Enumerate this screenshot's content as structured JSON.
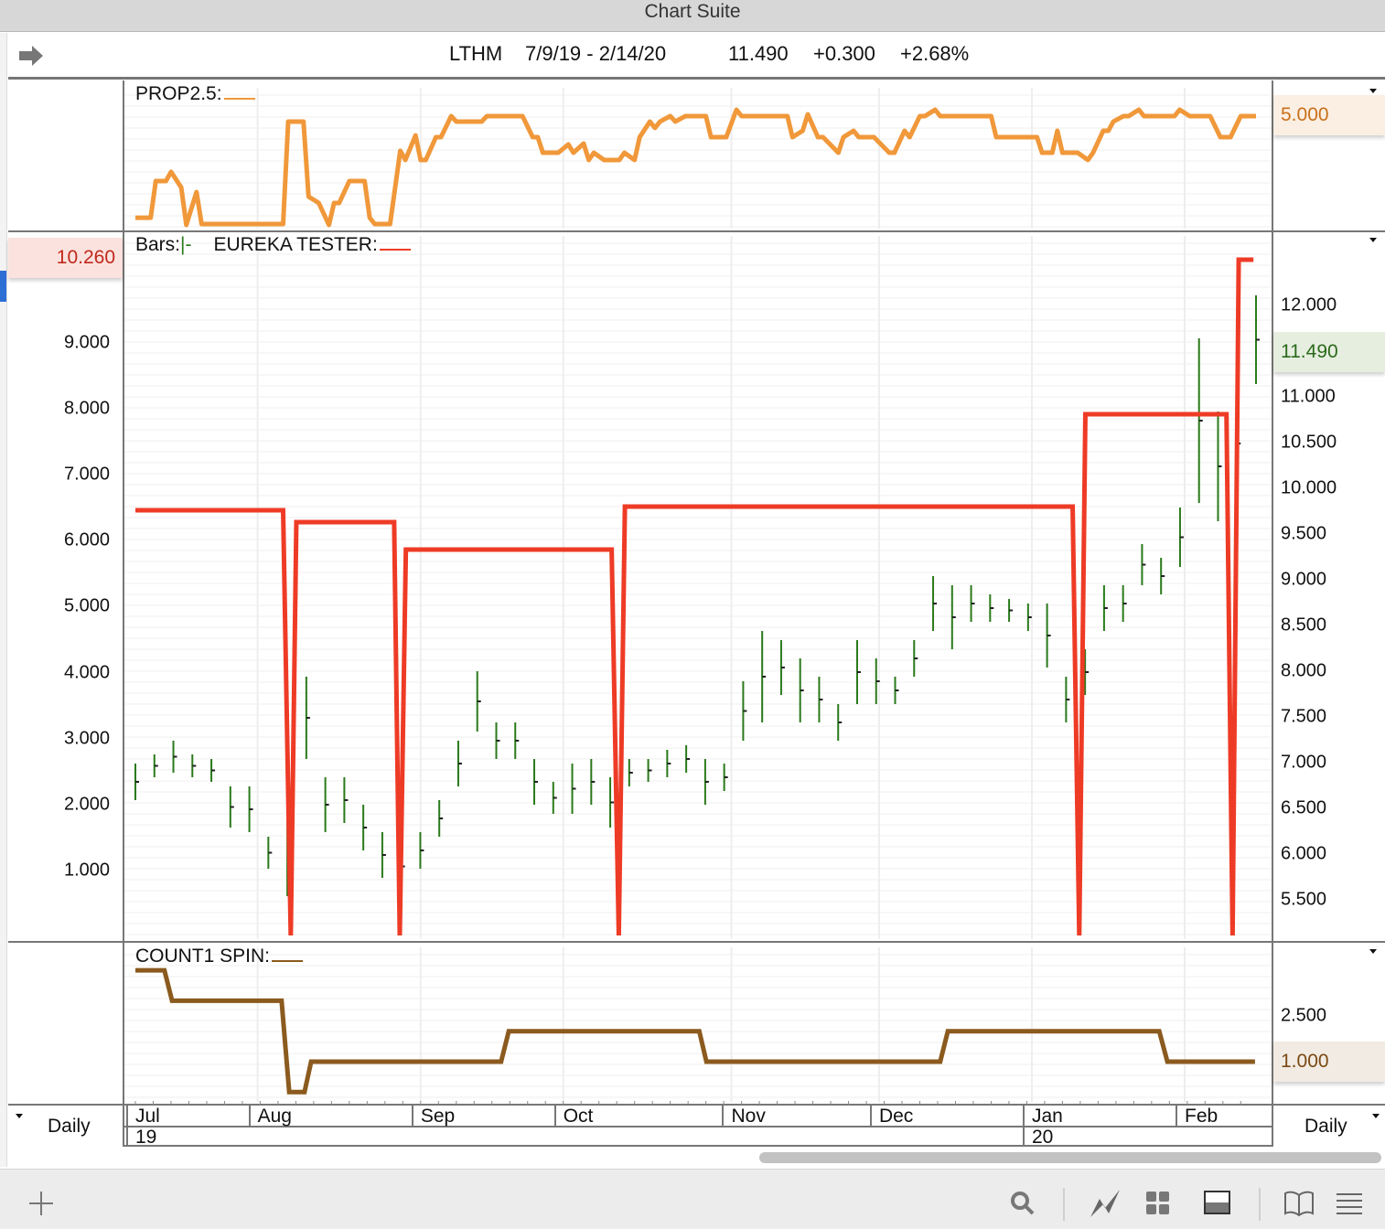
{
  "window": {
    "title": "Chart Suite"
  },
  "header": {
    "symbol": "LTHM",
    "range": "7/9/19 - 2/14/20",
    "last": "11.490",
    "change": "+0.300",
    "pct": "+2.68%"
  },
  "panels": {
    "top": {
      "label": "PROP2.5:",
      "badge": "5.000",
      "color": "#f0983a"
    },
    "main": {
      "bars_label": "Bars:",
      "bars_marker": "|-",
      "study_label": "EUREKA TESTER:",
      "left_badge": "10.260",
      "right_badge": "11.490",
      "bar_color": "#2a7a1a",
      "study_color": "#ee3b26",
      "left_axis": [
        "9.000",
        "8.000",
        "7.000",
        "6.000",
        "5.000",
        "4.000",
        "3.000",
        "2.000",
        "1.000"
      ],
      "right_axis": [
        "12.000",
        "11.000",
        "10.500",
        "10.000",
        "9.500",
        "9.000",
        "8.500",
        "8.000",
        "7.500",
        "7.000",
        "6.500",
        "6.000",
        "5.500"
      ]
    },
    "bottom": {
      "label": "COUNT1 SPIN:",
      "axis": [
        "2.500"
      ],
      "badge": "1.000",
      "color": "#8b5a1e"
    }
  },
  "time_axis": {
    "left_period": "Daily",
    "right_period": "Daily",
    "months": [
      {
        "label": "Jul",
        "day": 0
      },
      {
        "label": "Aug",
        "day": 24
      },
      {
        "label": "Sep",
        "day": 56
      },
      {
        "label": "Oct",
        "day": 84
      },
      {
        "label": "Nov",
        "day": 117
      },
      {
        "label": "Dec",
        "day": 146
      },
      {
        "label": "Jan",
        "day": 176
      },
      {
        "label": "Feb",
        "day": 206
      }
    ],
    "years": [
      {
        "label": "19",
        "day": 0
      },
      {
        "label": "20",
        "day": 176
      }
    ]
  },
  "chart_data": [
    {
      "type": "line",
      "title": "PROP2.5",
      "x_unit": "days since 7/9/19",
      "xlim": [
        0,
        220
      ],
      "ylim": [
        0,
        5.2
      ],
      "points": [
        [
          0,
          0.33
        ],
        [
          3,
          0.33
        ],
        [
          4,
          2
        ],
        [
          6,
          2
        ],
        [
          7,
          2.42
        ],
        [
          9,
          1.71
        ],
        [
          10,
          0
        ],
        [
          12,
          1.5
        ],
        [
          13,
          0.04
        ],
        [
          29,
          0.04
        ],
        [
          30,
          4.71
        ],
        [
          33,
          4.71
        ],
        [
          34,
          1.29
        ],
        [
          36,
          1
        ],
        [
          38,
          0
        ],
        [
          39,
          1
        ],
        [
          40,
          1
        ],
        [
          42,
          2
        ],
        [
          45,
          2
        ],
        [
          46,
          0.33
        ],
        [
          47,
          0.04
        ],
        [
          50,
          0.04
        ],
        [
          52,
          3.38
        ],
        [
          53,
          2.96
        ],
        [
          55,
          4.08
        ],
        [
          56,
          2.96
        ],
        [
          57,
          2.96
        ],
        [
          59,
          4
        ],
        [
          60,
          4
        ],
        [
          62,
          4.96
        ],
        [
          63,
          4.71
        ],
        [
          68,
          4.71
        ],
        [
          69,
          4.96
        ],
        [
          76,
          4.96
        ],
        [
          78,
          4
        ],
        [
          79,
          4
        ],
        [
          80,
          3.29
        ],
        [
          83,
          3.29
        ],
        [
          85,
          3.67
        ],
        [
          86,
          3.29
        ],
        [
          88,
          3.71
        ],
        [
          89,
          2.96
        ],
        [
          90,
          3.29
        ],
        [
          92,
          2.96
        ],
        [
          95,
          2.96
        ],
        [
          96,
          3.29
        ],
        [
          98,
          2.96
        ],
        [
          99,
          4
        ],
        [
          101,
          4.71
        ],
        [
          102,
          4.42
        ],
        [
          103,
          4.71
        ],
        [
          105,
          4.96
        ],
        [
          106,
          4.71
        ],
        [
          108,
          4.96
        ],
        [
          112,
          4.96
        ],
        [
          113,
          4
        ],
        [
          116,
          4
        ],
        [
          118,
          5.25
        ],
        [
          119,
          4.96
        ],
        [
          128,
          4.96
        ],
        [
          129,
          4
        ],
        [
          131,
          4.29
        ],
        [
          132,
          5.04
        ],
        [
          134,
          4
        ],
        [
          135,
          4
        ],
        [
          138,
          3.29
        ],
        [
          139,
          4
        ],
        [
          141,
          4.29
        ],
        [
          142,
          4
        ],
        [
          145,
          4
        ],
        [
          148,
          3.29
        ],
        [
          149,
          3.29
        ],
        [
          151,
          4.29
        ],
        [
          152,
          4
        ],
        [
          154,
          4.96
        ],
        [
          155,
          4.96
        ],
        [
          157,
          5.25
        ],
        [
          158,
          4.96
        ],
        [
          168,
          4.96
        ],
        [
          169,
          4
        ],
        [
          177,
          4
        ],
        [
          178,
          3.29
        ],
        [
          180,
          3.29
        ],
        [
          181,
          4.29
        ],
        [
          182,
          3.29
        ],
        [
          185,
          3.29
        ],
        [
          187,
          2.96
        ],
        [
          188,
          3.29
        ],
        [
          190,
          4.29
        ],
        [
          191,
          4.29
        ],
        [
          192,
          4.71
        ],
        [
          194,
          4.96
        ],
        [
          195,
          4.96
        ],
        [
          197,
          5.25
        ],
        [
          198,
          4.96
        ],
        [
          204,
          4.96
        ],
        [
          205,
          5.25
        ],
        [
          207,
          4.96
        ],
        [
          211,
          4.96
        ],
        [
          213,
          4
        ],
        [
          215,
          4
        ],
        [
          217,
          4.96
        ],
        [
          220,
          4.96
        ]
      ]
    },
    {
      "type": "ohlc",
      "title": "LTHM Bars",
      "x_unit": "evenly spaced trading bars",
      "ylim": [
        5.11,
        12.5
      ],
      "bars": [
        [
          6.99,
          6.59
        ],
        [
          7.09,
          6.84
        ],
        [
          7.24,
          6.89
        ],
        [
          7.09,
          6.84
        ],
        [
          7.04,
          6.79
        ],
        [
          6.74,
          6.29
        ],
        [
          6.74,
          6.24
        ],
        [
          6.19,
          5.84
        ],
        [
          6.84,
          5.54
        ],
        [
          7.94,
          7.04
        ],
        [
          6.84,
          6.24
        ],
        [
          6.84,
          6.34
        ],
        [
          6.54,
          6.04
        ],
        [
          6.24,
          5.74
        ],
        [
          6.14,
          5.59
        ],
        [
          6.24,
          5.84
        ],
        [
          6.59,
          6.19
        ],
        [
          7.24,
          6.74
        ],
        [
          8.0,
          7.34
        ],
        [
          7.44,
          7.04
        ],
        [
          7.44,
          7.04
        ],
        [
          7.04,
          6.54
        ],
        [
          6.79,
          6.44
        ],
        [
          6.99,
          6.44
        ],
        [
          7.04,
          6.54
        ],
        [
          6.84,
          6.29
        ],
        [
          7.04,
          6.74
        ],
        [
          7.04,
          6.79
        ],
        [
          7.14,
          6.84
        ],
        [
          7.19,
          6.89
        ],
        [
          7.04,
          6.54
        ],
        [
          6.99,
          6.69
        ],
        [
          7.89,
          7.24
        ],
        [
          8.44,
          7.44
        ],
        [
          8.34,
          7.74
        ],
        [
          8.14,
          7.44
        ],
        [
          7.94,
          7.44
        ],
        [
          7.64,
          7.24
        ],
        [
          8.34,
          7.64
        ],
        [
          8.14,
          7.64
        ],
        [
          7.94,
          7.64
        ],
        [
          8.34,
          7.94
        ],
        [
          9.04,
          8.44
        ],
        [
          8.94,
          8.24
        ],
        [
          8.94,
          8.54
        ],
        [
          8.84,
          8.54
        ],
        [
          8.79,
          8.54
        ],
        [
          8.74,
          8.44
        ],
        [
          8.74,
          8.04
        ],
        [
          7.94,
          7.44
        ],
        [
          8.24,
          7.74
        ],
        [
          8.94,
          8.44
        ],
        [
          8.94,
          8.54
        ],
        [
          9.39,
          8.94
        ],
        [
          9.24,
          8.84
        ],
        [
          9.79,
          9.14
        ],
        [
          11.64,
          9.84
        ],
        [
          10.84,
          9.64
        ],
        [
          11.14,
          9.84
        ],
        [
          12.11,
          11.14
        ]
      ]
    },
    {
      "type": "line",
      "title": "EUREKA TESTER",
      "x_unit": "days since 7/9/19",
      "xlim": [
        0,
        220
      ],
      "points": [
        [
          0,
          9.76
        ],
        [
          29,
          9.76
        ],
        [
          30.5,
          5.11
        ],
        [
          31.6,
          9.63
        ],
        [
          50.8,
          9.63
        ],
        [
          51.9,
          5.11
        ],
        [
          53.1,
          9.33
        ],
        [
          93.5,
          9.33
        ],
        [
          94.9,
          5.11
        ],
        [
          96.1,
          9.8
        ],
        [
          184,
          9.8
        ],
        [
          185.3,
          5.11
        ],
        [
          186.5,
          10.81
        ],
        [
          214.2,
          10.81
        ],
        [
          215.4,
          5.11
        ],
        [
          216.6,
          12.5
        ],
        [
          219.5,
          12.5
        ]
      ]
    },
    {
      "type": "line",
      "title": "COUNT1 SPIN",
      "x_unit": "days since 7/9/19",
      "xlim": [
        0,
        220
      ],
      "ylim": [
        -0.3,
        4.5
      ],
      "points": [
        [
          0,
          4
        ],
        [
          5.7,
          4
        ],
        [
          7.2,
          3
        ],
        [
          28.7,
          3
        ],
        [
          30.2,
          0
        ],
        [
          33.2,
          0
        ],
        [
          34.5,
          1
        ],
        [
          71.8,
          1
        ],
        [
          73.3,
          2
        ],
        [
          110.7,
          2
        ],
        [
          112.1,
          1
        ],
        [
          158,
          1
        ],
        [
          159.5,
          2
        ],
        [
          201,
          2
        ],
        [
          202.6,
          1
        ],
        [
          219.8,
          1
        ]
      ]
    }
  ],
  "toolbar": {
    "icons": [
      "add-icon",
      "search-icon",
      "chart-style-icon",
      "grid-layout-icon",
      "panel-layout-icon",
      "book-icon",
      "menu-icon"
    ]
  }
}
